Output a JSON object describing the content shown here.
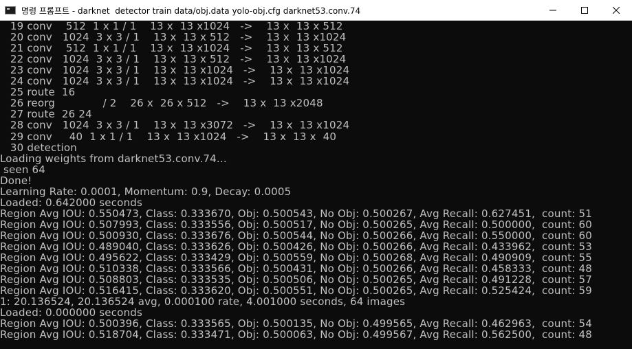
{
  "window": {
    "title": "명령 프롬프트 - darknet  detector train data/obj.data yolo-obj.cfg darknet53.conv.74",
    "minimize_icon": "minimize-icon",
    "maximize_icon": "maximize-icon",
    "close_icon": "close-icon",
    "app_icon": "cmd-icon"
  },
  "colors": {
    "console_bg": "#0c0c0c",
    "console_text": "#c0c0c0",
    "titlebar_bg": "#ffffff"
  },
  "console": {
    "lines": [
      "   19 conv    512  1 x 1 / 1    13 x  13 x1024   ->    13 x  13 x 512",
      "   20 conv   1024  3 x 3 / 1    13 x  13 x 512   ->    13 x  13 x1024",
      "   21 conv    512  1 x 1 / 1    13 x  13 x1024   ->    13 x  13 x 512",
      "   22 conv   1024  3 x 3 / 1    13 x  13 x 512   ->    13 x  13 x1024",
      "   23 conv   1024  3 x 3 / 1    13 x  13 x1024   ->    13 x  13 x1024",
      "   24 conv   1024  3 x 3 / 1    13 x  13 x1024   ->    13 x  13 x1024",
      "   25 route  16",
      "   26 reorg              / 2    26 x  26 x 512   ->    13 x  13 x2048",
      "   27 route  26 24",
      "   28 conv   1024  3 x 3 / 1    13 x  13 x3072   ->    13 x  13 x1024",
      "   29 conv     40  1 x 1 / 1    13 x  13 x1024   ->    13 x  13 x  40",
      "   30 detection",
      "Loading weights from darknet53.conv.74...",
      " seen 64",
      "Done!",
      "Learning Rate: 0.0001, Momentum: 0.9, Decay: 0.0005",
      "Loaded: 0.642000 seconds",
      "Region Avg IOU: 0.550473, Class: 0.333670, Obj: 0.500543, No Obj: 0.500267, Avg Recall: 0.627451,  count: 51",
      "Region Avg IOU: 0.507993, Class: 0.333556, Obj: 0.500517, No Obj: 0.500265, Avg Recall: 0.500000,  count: 60",
      "Region Avg IOU: 0.500930, Class: 0.333676, Obj: 0.500544, No Obj: 0.500266, Avg Recall: 0.550000,  count: 60",
      "Region Avg IOU: 0.489040, Class: 0.333626, Obj: 0.500426, No Obj: 0.500266, Avg Recall: 0.433962,  count: 53",
      "Region Avg IOU: 0.495622, Class: 0.333429, Obj: 0.500559, No Obj: 0.500268, Avg Recall: 0.490909,  count: 55",
      "Region Avg IOU: 0.510338, Class: 0.333566, Obj: 0.500431, No Obj: 0.500266, Avg Recall: 0.458333,  count: 48",
      "Region Avg IOU: 0.508803, Class: 0.333535, Obj: 0.500506, No Obj: 0.500265, Avg Recall: 0.491228,  count: 57",
      "Region Avg IOU: 0.516415, Class: 0.333620, Obj: 0.500551, No Obj: 0.500265, Avg Recall: 0.525424,  count: 59",
      "1: 20.136524, 20.136524 avg, 0.000100 rate, 4.001000 seconds, 64 images",
      "Loaded: 0.000000 seconds",
      "Region Avg IOU: 0.500396, Class: 0.333565, Obj: 0.500135, No Obj: 0.499565, Avg Recall: 0.462963,  count: 54",
      "Region Avg IOU: 0.518704, Class: 0.333471, Obj: 0.500063, No Obj: 0.499567, Avg Recall: 0.562500,  count: 48"
    ]
  }
}
